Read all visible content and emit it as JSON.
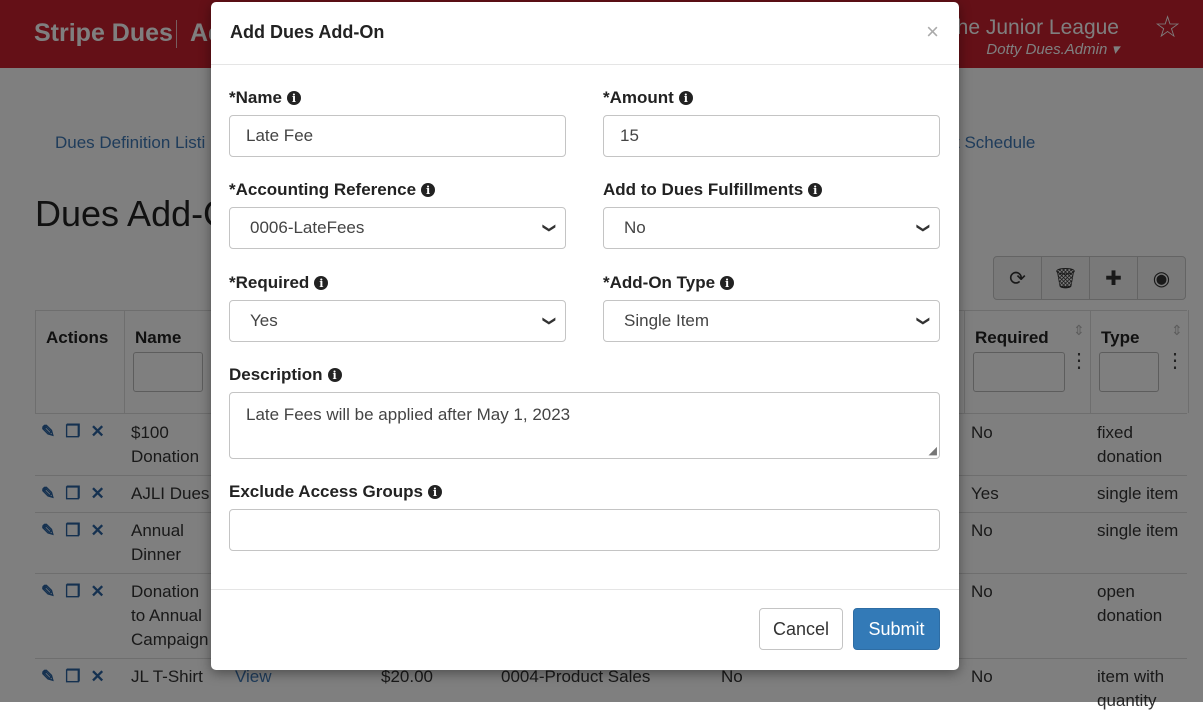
{
  "app": {
    "brand": "Stripe Dues",
    "brand_sub": "Ad",
    "org": "The Junior League",
    "user": "Dotty Dues.Admin"
  },
  "subnav": {
    "left": "Dues Definition Listi",
    "right": "t Schedule"
  },
  "page_title": "Dues Add-O",
  "table": {
    "headers": {
      "actions": "Actions",
      "name": "Name",
      "required": "Required",
      "type": "Type"
    },
    "rows": [
      {
        "name": "$100 Donation",
        "required": "No",
        "type": "fixed donation"
      },
      {
        "name": "AJLI Dues",
        "required": "Yes",
        "type": "single item"
      },
      {
        "name": "Annual Dinner",
        "required": "No",
        "type": "single item"
      },
      {
        "name": "Donation to Annual Campaign",
        "required": "No",
        "type": "open donation"
      },
      {
        "name": "JL T-Shirt",
        "view": "View",
        "amount": "$20.00",
        "accounting": "0004-Product Sales",
        "fulfillment": "No",
        "required": "No",
        "type": "item with quantity"
      }
    ]
  },
  "modal": {
    "title": "Add Dues Add-On",
    "close": "×",
    "fields": {
      "name": {
        "label": "*Name",
        "value": "Late Fee"
      },
      "amount": {
        "label": "*Amount",
        "value": "15"
      },
      "accounting": {
        "label": "*Accounting Reference",
        "value": "0006-LateFees"
      },
      "fulfillments": {
        "label": "Add to Dues Fulfillments",
        "value": "No"
      },
      "required": {
        "label": "*Required",
        "value": "Yes"
      },
      "addon_type": {
        "label": "*Add-On Type",
        "value": "Single Item"
      },
      "description": {
        "label": "Description",
        "value": "Late Fees will be applied after May 1, 2023"
      },
      "exclude": {
        "label": "Exclude Access Groups",
        "value": ""
      }
    },
    "buttons": {
      "cancel": "Cancel",
      "submit": "Submit"
    }
  }
}
